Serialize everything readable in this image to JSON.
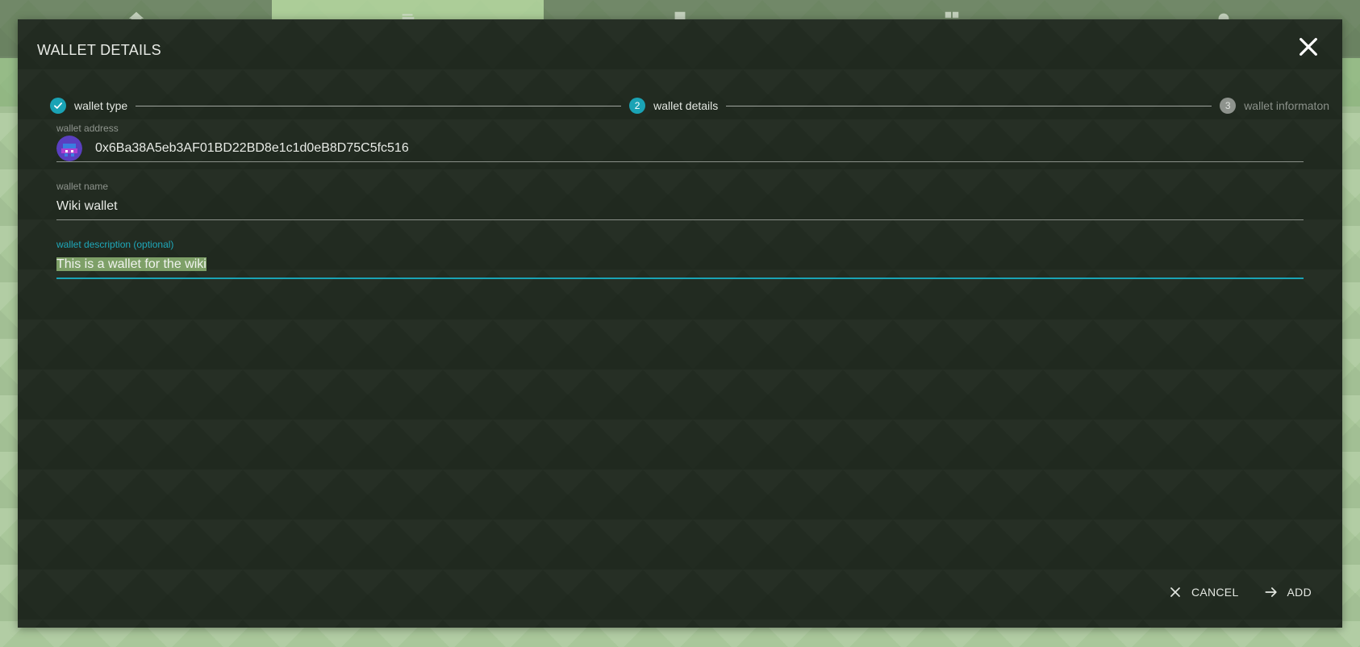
{
  "dialog": {
    "title": "WALLET DETAILS",
    "close_icon": "close-icon"
  },
  "stepper": {
    "steps": [
      {
        "number": "1",
        "label": "wallet type",
        "state": "done"
      },
      {
        "number": "2",
        "label": "wallet details",
        "state": "current"
      },
      {
        "number": "3",
        "label": "wallet informaton",
        "state": "pending"
      }
    ]
  },
  "form": {
    "address": {
      "label": "wallet address",
      "value": "0x6Ba38A5eb3AF01BD22BD8e1c1d0eB8D75C5fc516"
    },
    "name": {
      "label": "wallet name",
      "value": "Wiki wallet"
    },
    "description": {
      "label": "wallet description (optional)",
      "value": "This is a wallet for the wiki"
    }
  },
  "actions": {
    "cancel_label": "CANCEL",
    "add_label": "ADD"
  },
  "colors": {
    "accent": "#1aa3b5",
    "dialog_bg": "#222b21",
    "page_bg": "#a9c79a",
    "selection": "#7ea068"
  }
}
